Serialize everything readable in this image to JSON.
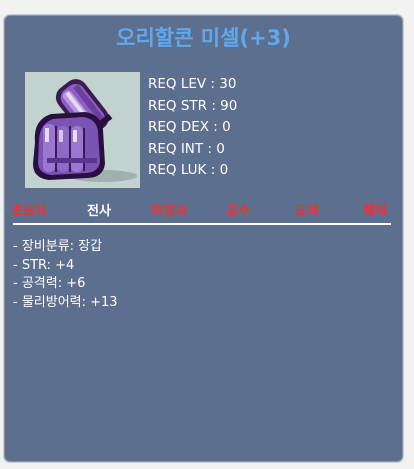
{
  "item": {
    "name": "오리할콘 미셀(+3)",
    "icon": "purple-glove-icon",
    "requirements": [
      {
        "label": "REQ LEV",
        "value": "30"
      },
      {
        "label": "REQ STR",
        "value": "90"
      },
      {
        "label": "REQ DEX",
        "value": "0"
      },
      {
        "label": "REQ INT",
        "value": "0"
      },
      {
        "label": "REQ LUK",
        "value": "0"
      }
    ],
    "jobs": [
      {
        "name": "초보자",
        "color": "#ff2a2a"
      },
      {
        "name": "전사",
        "color": "#ffffff"
      },
      {
        "name": "마법사",
        "color": "#ff2a2a"
      },
      {
        "name": "궁수",
        "color": "#ff2a2a"
      },
      {
        "name": "도적",
        "color": "#ff2a2a"
      },
      {
        "name": "해적",
        "color": "#ff2a2a"
      }
    ],
    "stats": [
      "- 장비분류: 장갑",
      "- STR: +4",
      "- 공격력: +6",
      "- 물리방어력: +13"
    ]
  }
}
